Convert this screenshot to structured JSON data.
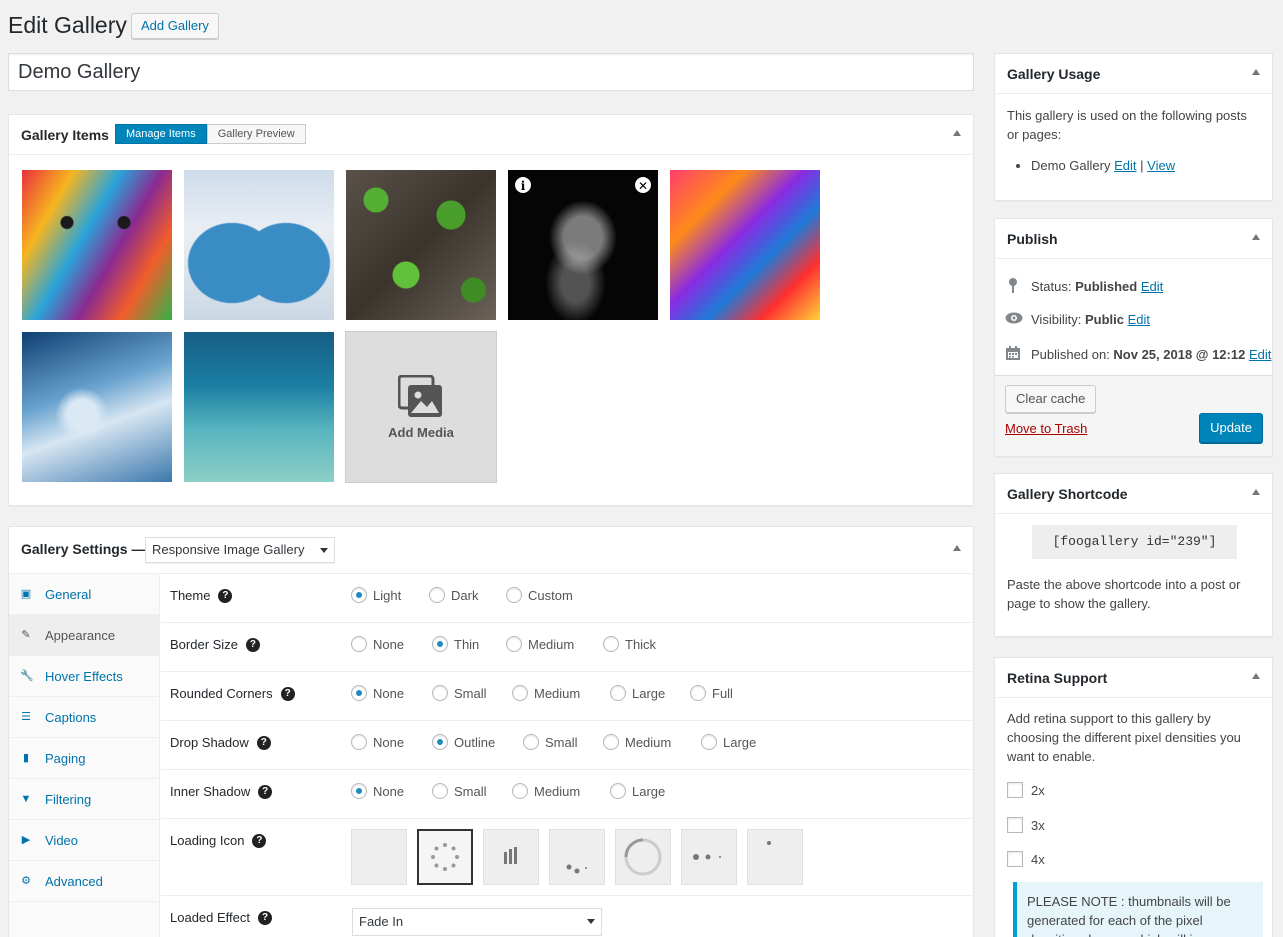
{
  "header": {
    "title": "Edit Gallery",
    "add_button": "Add Gallery",
    "gallery_title_value": "Demo Gallery"
  },
  "gallery_items": {
    "title": "Gallery Items",
    "tabs": [
      {
        "label": "Manage Items",
        "active": true
      },
      {
        "label": "Gallery Preview",
        "active": false
      }
    ],
    "add_media_label": "Add Media",
    "info_glyph": "i",
    "close_glyph": "✕"
  },
  "gallery_settings": {
    "title": "Gallery Settings —",
    "template": "Responsive Image Gallery",
    "nav": [
      {
        "label": "General",
        "icon": "image-icon",
        "glyph": "▣",
        "active": false
      },
      {
        "label": "Appearance",
        "icon": "brush-icon",
        "glyph": "✎",
        "active": true
      },
      {
        "label": "Hover Effects",
        "icon": "wrench-icon",
        "glyph": "🔧",
        "active": false
      },
      {
        "label": "Captions",
        "icon": "captions-icon",
        "glyph": "☰",
        "active": false
      },
      {
        "label": "Paging",
        "icon": "page-icon",
        "glyph": "▮",
        "active": false
      },
      {
        "label": "Filtering",
        "icon": "filter-icon",
        "glyph": "▼",
        "active": false
      },
      {
        "label": "Video",
        "icon": "video-icon",
        "glyph": "▶",
        "active": false
      },
      {
        "label": "Advanced",
        "icon": "gear-icon",
        "glyph": "⚙",
        "active": false
      }
    ],
    "help_glyph": "?",
    "rows": {
      "theme": {
        "label": "Theme",
        "options": [
          "Light",
          "Dark",
          "Custom"
        ],
        "selected": 0
      },
      "border_size": {
        "label": "Border Size",
        "options": [
          "None",
          "Thin",
          "Medium",
          "Thick"
        ],
        "selected": 1
      },
      "rounded_corners": {
        "label": "Rounded Corners",
        "options": [
          "None",
          "Small",
          "Medium",
          "Large",
          "Full"
        ],
        "selected": 0
      },
      "drop_shadow": {
        "label": "Drop Shadow",
        "options": [
          "None",
          "Outline",
          "Small",
          "Medium",
          "Large"
        ],
        "selected": 1
      },
      "inner_shadow": {
        "label": "Inner Shadow",
        "options": [
          "None",
          "Small",
          "Medium",
          "Large"
        ],
        "selected": 0
      },
      "loading_icon": {
        "label": "Loading Icon",
        "selected": 1
      },
      "loaded_effect": {
        "label": "Loaded Effect",
        "value": "Fade In"
      }
    }
  },
  "gallery_usage": {
    "title": "Gallery Usage",
    "text": "This gallery is used on the following posts or pages:",
    "item_name": "Demo Gallery",
    "edit": "Edit",
    "separator": "|",
    "view": "View"
  },
  "publish": {
    "title": "Publish",
    "status_label": "Status:",
    "status_value": "Published",
    "visibility_label": "Visibility:",
    "visibility_value": "Public",
    "published_label": "Published on:",
    "published_value": "Nov 25, 2018 @ 12:12",
    "edit": "Edit",
    "clear_cache": "Clear cache",
    "trash": "Move to Trash",
    "update": "Update"
  },
  "shortcode": {
    "title": "Gallery Shortcode",
    "code": "[foogallery id=\"239\"]",
    "help": "Paste the above shortcode into a post or page to show the gallery."
  },
  "retina": {
    "title": "Retina Support",
    "text": "Add retina support to this gallery by choosing the different pixel densities you want to enable.",
    "options": [
      "2x",
      "3x",
      "4x"
    ],
    "note": "PLEASE NOTE : thumbnails will be generated for each of the pixel densities chosen, which will increase"
  },
  "colors": {
    "primary": "#0085ba",
    "link": "#0073aa",
    "trash": "#aa0000"
  }
}
